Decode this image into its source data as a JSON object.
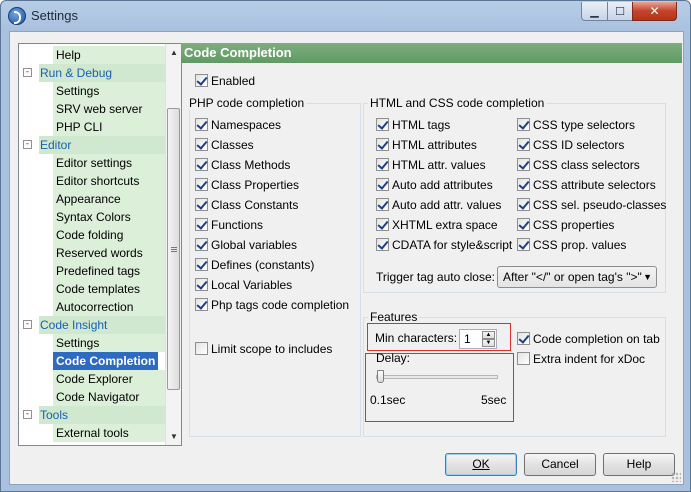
{
  "window": {
    "title": "Settings"
  },
  "titlebar_buttons": {
    "minimize": "▁",
    "maximize": "☐",
    "close": "✕"
  },
  "sidebar": {
    "items": [
      {
        "label": "Help",
        "type": "child"
      },
      {
        "label": "Run & Debug",
        "type": "category",
        "expander": "-"
      },
      {
        "label": "Settings",
        "type": "child"
      },
      {
        "label": "SRV web server",
        "type": "child"
      },
      {
        "label": "PHP CLI",
        "type": "child"
      },
      {
        "label": "Editor",
        "type": "category",
        "expander": "-"
      },
      {
        "label": "Editor settings",
        "type": "child"
      },
      {
        "label": "Editor shortcuts",
        "type": "child"
      },
      {
        "label": "Appearance",
        "type": "child"
      },
      {
        "label": "Syntax Colors",
        "type": "child"
      },
      {
        "label": "Code folding",
        "type": "child"
      },
      {
        "label": "Reserved words",
        "type": "child"
      },
      {
        "label": "Predefined tags",
        "type": "child"
      },
      {
        "label": "Code templates",
        "type": "child"
      },
      {
        "label": "Autocorrection",
        "type": "child"
      },
      {
        "label": "Code Insight",
        "type": "category",
        "expander": "-"
      },
      {
        "label": "Settings",
        "type": "child"
      },
      {
        "label": "Code Completion",
        "type": "child",
        "selected": true
      },
      {
        "label": "Code Explorer",
        "type": "child"
      },
      {
        "label": "Code Navigator",
        "type": "child"
      },
      {
        "label": "Tools",
        "type": "category",
        "expander": "-"
      },
      {
        "label": "External tools",
        "type": "child"
      }
    ]
  },
  "panel": {
    "header": "Code Completion",
    "enabled": {
      "label": "Enabled",
      "checked": true
    },
    "php_group": {
      "title": "PHP code completion",
      "items": [
        {
          "label": "Namespaces",
          "checked": true
        },
        {
          "label": "Classes",
          "checked": true
        },
        {
          "label": "Class Methods",
          "checked": true
        },
        {
          "label": "Class Properties",
          "checked": true
        },
        {
          "label": "Class Constants",
          "checked": true
        },
        {
          "label": "Functions",
          "checked": true
        },
        {
          "label": "Global variables",
          "checked": true
        },
        {
          "label": "Defines (constants)",
          "checked": true
        },
        {
          "label": "Local Variables",
          "checked": true
        },
        {
          "label": "Php tags code completion",
          "checked": true
        }
      ],
      "limit_scope": {
        "label": "Limit scope to includes",
        "checked": false
      }
    },
    "html_group": {
      "title": "HTML and CSS code completion",
      "left": [
        {
          "label": "HTML tags",
          "checked": true
        },
        {
          "label": "HTML attributes",
          "checked": true
        },
        {
          "label": "HTML attr. values",
          "checked": true
        },
        {
          "label": "Auto add attributes",
          "checked": true
        },
        {
          "label": "Auto add attr. values",
          "checked": true
        },
        {
          "label": "XHTML extra space",
          "checked": true
        },
        {
          "label": "CDATA for style&script",
          "checked": true
        }
      ],
      "right": [
        {
          "label": "CSS type selectors",
          "checked": true
        },
        {
          "label": "CSS ID selectors",
          "checked": true
        },
        {
          "label": "CSS class selectors",
          "checked": true
        },
        {
          "label": "CSS attribute selectors",
          "checked": true
        },
        {
          "label": "CSS sel. pseudo-classes",
          "checked": true
        },
        {
          "label": "CSS properties",
          "checked": true
        },
        {
          "label": "CSS prop. values",
          "checked": true
        }
      ],
      "trigger_label": "Trigger tag auto close:",
      "trigger_value": "After \"</\" or open tag's \">\""
    },
    "features": {
      "title": "Features",
      "min_chars_label": "Min characters:",
      "min_chars_value": "1",
      "delay_label": "Delay:",
      "delay_min": "0.1sec",
      "delay_max": "5sec",
      "delay_level": 0.0,
      "code_completion_on_tab": {
        "label": "Code completion on tab",
        "checked": true
      },
      "extra_indent": {
        "label": "Extra indent for xDoc",
        "checked": false
      }
    }
  },
  "buttons": {
    "ok": "OK",
    "cancel": "Cancel",
    "help": "Help"
  }
}
